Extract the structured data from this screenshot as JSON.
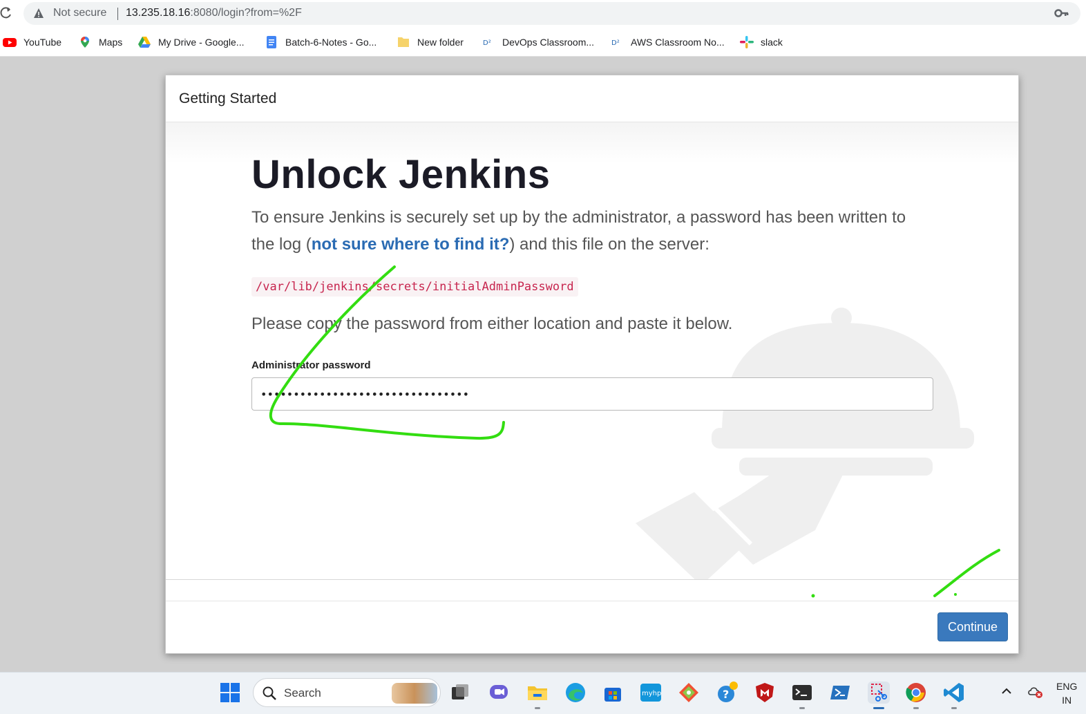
{
  "browser": {
    "security_label": "Not secure",
    "url_host": "13.235.18.16",
    "url_rest": ":8080/login?from=%2F",
    "bookmarks": [
      {
        "label": "YouTube",
        "icon": "youtube-icon"
      },
      {
        "label": "Maps",
        "icon": "maps-icon"
      },
      {
        "label": "My Drive - Google...",
        "icon": "google-drive-icon"
      },
      {
        "label": "Batch-6-Notes - Go...",
        "icon": "google-docs-icon"
      },
      {
        "label": "New folder",
        "icon": "folder-icon"
      },
      {
        "label": "DevOps Classroom...",
        "icon": "site-icon"
      },
      {
        "label": "AWS Classroom No...",
        "icon": "site-icon"
      },
      {
        "label": "slack",
        "icon": "slack-icon"
      }
    ]
  },
  "modal": {
    "title": "Getting Started",
    "heading": "Unlock Jenkins",
    "intro_part1": "To ensure Jenkins is securely set up by the administrator, a password has been written to the log (",
    "intro_link": "not sure where to find it?",
    "intro_part2": ") and this file on the server:",
    "password_path": "/var/lib/jenkins/secrets/initialAdminPassword",
    "instruction": "Please copy the password from either location and paste it below.",
    "password_label": "Administrator password",
    "password_value": "••••••••••••••••••••••••••••••••",
    "continue_label": "Continue"
  },
  "taskbar": {
    "search_placeholder": "Search",
    "tray_lang_line1": "ENG",
    "tray_lang_line2": "IN"
  },
  "colors": {
    "link": "#2a6bb3",
    "primary_button": "#3a79bd",
    "code_text": "#c7254e",
    "annotation": "#33dd11"
  }
}
